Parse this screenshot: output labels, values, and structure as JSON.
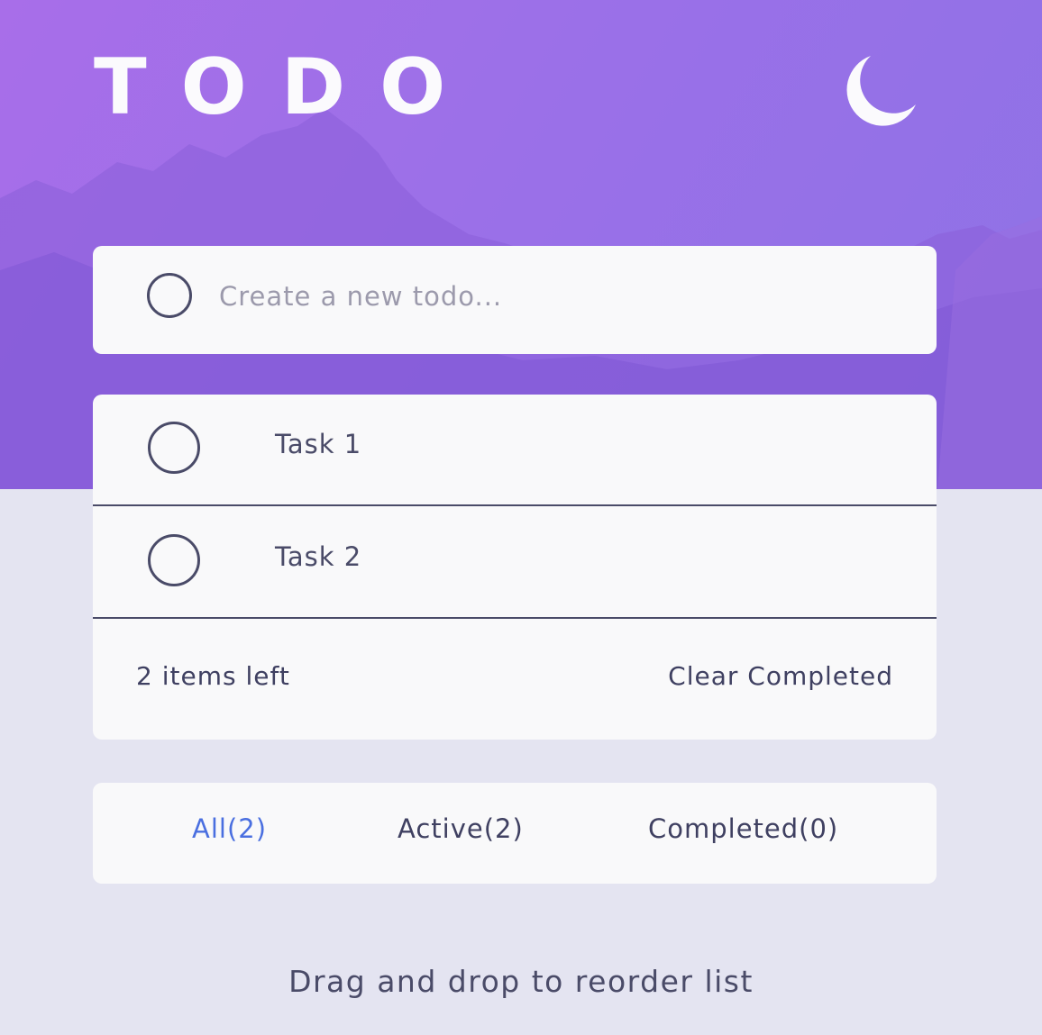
{
  "header": {
    "title": "TODO",
    "theme_icon": "moon-icon"
  },
  "new_todo": {
    "placeholder": "Create a new todo...",
    "value": ""
  },
  "todos": [
    {
      "label": "Task 1",
      "completed": false
    },
    {
      "label": "Task 2",
      "completed": false
    }
  ],
  "footer": {
    "items_left": "2 items left",
    "clear_label": "Clear Completed"
  },
  "filters": [
    {
      "label": "All(2)",
      "active": true
    },
    {
      "label": "Active(2)",
      "active": false
    },
    {
      "label": "Completed(0)",
      "active": false
    }
  ],
  "hint": "Drag and drop to reorder list",
  "colors": {
    "accent": "#4a6fe0",
    "background": "#e4e4f1",
    "card": "#f9f9fa",
    "text": "#4a4b68",
    "hero_start": "#a86ee9",
    "hero_end": "#8e72e6"
  }
}
